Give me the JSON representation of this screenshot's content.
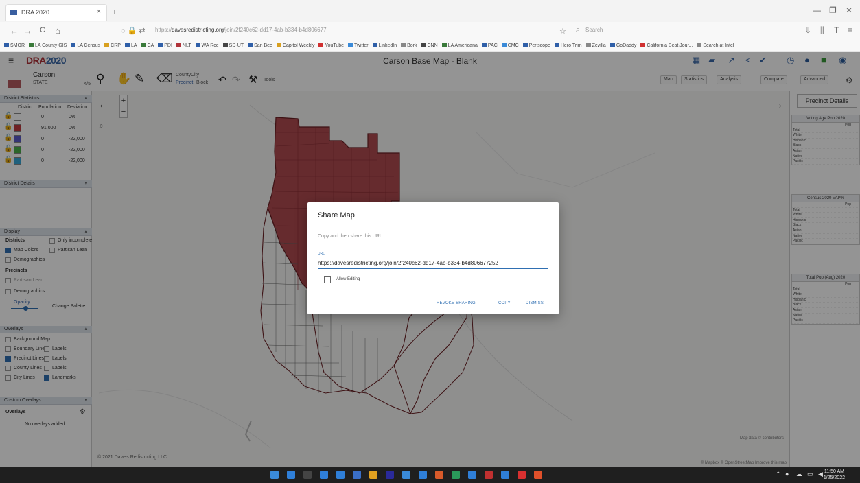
{
  "browser": {
    "tab_title": "DRA 2020",
    "tab_close": "×",
    "new_tab": "+",
    "back": "←",
    "forward": "→",
    "reload": "C",
    "home": "⌂",
    "url_prefix": "https://",
    "url_host": "davesredistricting.org",
    "url_rest": "/join/2f240c62-dd17-4ab-b334-b4d806677",
    "search_placeholder": "Search",
    "bookmarks": [
      {
        "label": "SMOR",
        "color": "#2f5fa8"
      },
      {
        "label": "LA County GIS",
        "color": "#3a7a3a"
      },
      {
        "label": "LA Census",
        "color": "#2f5fa8"
      },
      {
        "label": "CRP",
        "color": "#d8a020"
      },
      {
        "label": "LA",
        "color": "#2f5fa8"
      },
      {
        "label": "CA",
        "color": "#3a7a3a"
      },
      {
        "label": "PDI",
        "color": "#2f5fa8"
      },
      {
        "label": "NLT",
        "color": "#b0333a"
      },
      {
        "label": "WA Rce",
        "color": "#2f5fa8"
      },
      {
        "label": "SD-UT",
        "color": "#444"
      },
      {
        "label": "San Bee",
        "color": "#2f5fa8"
      },
      {
        "label": "Capitol Weekly",
        "color": "#d8a020"
      },
      {
        "label": "YouTube",
        "color": "#d03030"
      },
      {
        "label": "Twitter",
        "color": "#3a8ad8"
      },
      {
        "label": "LinkedIn",
        "color": "#2f5fa8"
      },
      {
        "label": "Bork",
        "color": "#888"
      },
      {
        "label": "CNN",
        "color": "#444"
      },
      {
        "label": "LA Americana",
        "color": "#3a7a3a"
      },
      {
        "label": "PAC",
        "color": "#2f5fa8"
      },
      {
        "label": "CMC",
        "color": "#3a8ad8"
      },
      {
        "label": "Periscope",
        "color": "#2f5fa8"
      },
      {
        "label": "Hero Trim",
        "color": "#2f5fa8"
      },
      {
        "label": "Zevilla",
        "color": "#888"
      },
      {
        "label": "GoDaddy",
        "color": "#2f5fa8"
      },
      {
        "label": "California Beat Jour...",
        "color": "#d03030"
      },
      {
        "label": "Search at Intel",
        "color": "#888"
      }
    ]
  },
  "app": {
    "logo_main": "DRA",
    "logo_year": "2020",
    "map_title": "Carson Base Map - Blank",
    "plan": {
      "name": "Carson",
      "type": "STATE",
      "count": "4/5"
    },
    "tool_labels": {
      "county": "County",
      "city": "City",
      "precinct": "Precinct",
      "block": "Block",
      "tools": "Tools"
    },
    "toolbar_buttons": [
      "Map",
      "Statistics",
      "Analysis",
      "Compare",
      "Advanced"
    ]
  },
  "left_panel": {
    "district_stats_header": "District Statistics",
    "columns": [
      "District",
      "Population",
      "Deviation"
    ],
    "districts": [
      {
        "id": "Un",
        "color": "#ffffff",
        "pop": "0",
        "dev": "0%"
      },
      {
        "id": "1",
        "color": "#c0393f",
        "pop": "91,000",
        "dev": "0%"
      },
      {
        "id": "2",
        "color": "#5a5ac8",
        "pop": "0",
        "dev": "-22,000"
      },
      {
        "id": "3",
        "color": "#4ab04a",
        "pop": "0",
        "dev": "-22,000"
      },
      {
        "id": "4",
        "color": "#38a8d8",
        "pop": "0",
        "dev": "-22,000"
      }
    ],
    "district_details_header": "District Details",
    "display_header": "Display",
    "districts_label": "Districts",
    "map_colors": "Map Colors",
    "only_incomplete": "Only incomplete",
    "partisan_lean": "Partisan Lean",
    "demographics": "Demographics",
    "precincts_label": "Precincts",
    "precinct_partisan": "Partisan Lean",
    "precinct_demo": "Demographics",
    "opacity": "Opacity",
    "change_palette": "Change Palette",
    "overlays_header": "Overlays",
    "overlay_items": [
      {
        "label": "Background Map",
        "checked": false
      },
      {
        "label": "Boundary Lines",
        "checked": false
      },
      {
        "label": "Labels",
        "checked": false
      },
      {
        "label": "Precinct Lines",
        "checked": true
      },
      {
        "label": "Labels",
        "checked": false
      },
      {
        "label": "County Lines",
        "checked": false
      },
      {
        "label": "Labels",
        "checked": false
      },
      {
        "label": "City Lines",
        "checked": false
      },
      {
        "label": "Landmarks",
        "checked": true
      }
    ],
    "custom_overlays_header": "Custom Overlays",
    "overlays_label": "Overlays",
    "no_overlays": "No overlays added"
  },
  "right_panel": {
    "title": "Precinct Details",
    "tables": [
      {
        "header": "Voting Age Pop 2020",
        "col": "Pop",
        "rows": [
          "Total",
          "White",
          "Hispanic",
          "Black",
          "Asian",
          "Native",
          "Pacific"
        ]
      },
      {
        "header": "Census 2020 VAP%",
        "col": "Pop",
        "rows": [
          "Total",
          "White",
          "Hispanic",
          "Black",
          "Asian",
          "Native",
          "Pacific"
        ]
      },
      {
        "header": "Total Pop (Aug) 2020",
        "col": "Pop",
        "rows": [
          "Total",
          "White",
          "Hispanic",
          "Black",
          "Asian",
          "Native",
          "Pacific"
        ]
      }
    ]
  },
  "map": {
    "zoom_in": "+",
    "zoom_out": "−",
    "copyright": "© 2021 Dave's Redistricting LLC",
    "attribution": "© Mapbox © OpenStreetMap  Improve this map",
    "scale": "Map data © contributors"
  },
  "dialog": {
    "title": "Share Map",
    "subtitle": "Copy and then share this URL.",
    "url_label": "URL",
    "url": "https://davesredistricting.org/join/2f240c62-dd17-4ab-b334-b4d806677252",
    "allow_editing": "Allow Editing",
    "btn_revoke": "REVOKE SHARING",
    "btn_copy": "COPY",
    "btn_dismiss": "DISMISS"
  },
  "taskbar": {
    "apps": [
      "#2f7fd8",
      "#444",
      "#2f7fd8",
      "#2f7fd8",
      "#3a6fc8",
      "#e0a020",
      "#2a2a9a",
      "#3a8ad8",
      "#2f7fd8",
      "#d85a2a",
      "#2a9a5a",
      "#2f7fd8",
      "#c03030",
      "#2f7fd8",
      "#d83030",
      "#e0502a"
    ],
    "time": "11:50 AM",
    "date": "1/25/2022"
  }
}
